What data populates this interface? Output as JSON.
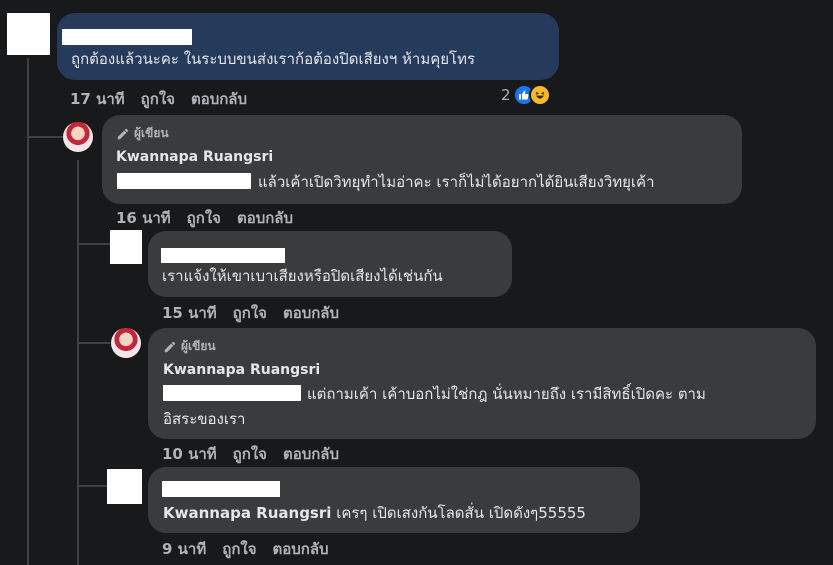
{
  "comments": [
    {
      "id": "c1",
      "author_badge": "",
      "name": "",
      "text": "ถูกต้องแล้วนะคะ ในระบบขนส่งเราก้อต้องปิดเสียงฯ ห้ามคุยโทร",
      "time": "17 นาที",
      "like": "ถูกใจ",
      "reply": "ตอบกลับ",
      "reaction_count": "2"
    },
    {
      "id": "c2",
      "author_badge": "ผู้เขียน",
      "name": "Kwannapa Ruangsri",
      "text": "แล้วเค้าเปิดวิทยุทำไมอ่าคะ เราก็ไม่ได้อยากได้ยินเสียงวิทยุเค้า",
      "time": "16 นาที",
      "like": "ถูกใจ",
      "reply": "ตอบกลับ"
    },
    {
      "id": "c3",
      "author_badge": "",
      "name": "",
      "text": "เราแจ้งให้เขาเบาเสียงหรือปิดเสียงได้เช่นกัน",
      "time": "15 นาที",
      "like": "ถูกใจ",
      "reply": "ตอบกลับ"
    },
    {
      "id": "c4",
      "author_badge": "ผู้เขียน",
      "name": "Kwannapa Ruangsri",
      "text_line1": "แต่ถามเค้า เค้าบอกไม่ใช่กฎ นั่นหมายถึง เรามีสิทธิ์เปิดคะ ตาม",
      "text_line2": "อิสระของเรา",
      "time": "10 นาที",
      "like": "ถูกใจ",
      "reply": "ตอบกลับ"
    },
    {
      "id": "c5",
      "author_badge": "",
      "name": "",
      "mention": "Kwannapa Ruangsri",
      "text": "เครๆ เปิดเสงกันโลดสั่น เปิดดังๆ55555",
      "time": "9 นาที",
      "like": "ถูกใจ",
      "reply": "ตอบกลับ"
    }
  ],
  "colors": {
    "background": "#18191a",
    "bubble": "#3a3b3c",
    "bubble_highlight": "#263a5c",
    "text": "#e4e6eb",
    "secondary_text": "#b0b3b8",
    "like_blue": "#1877f2",
    "haha_yellow": "#f7b928"
  },
  "icons": {
    "author_badge": "pencil-icon",
    "reaction_like": "thumbs-up-icon",
    "reaction_haha": "haha-emoji-icon"
  }
}
